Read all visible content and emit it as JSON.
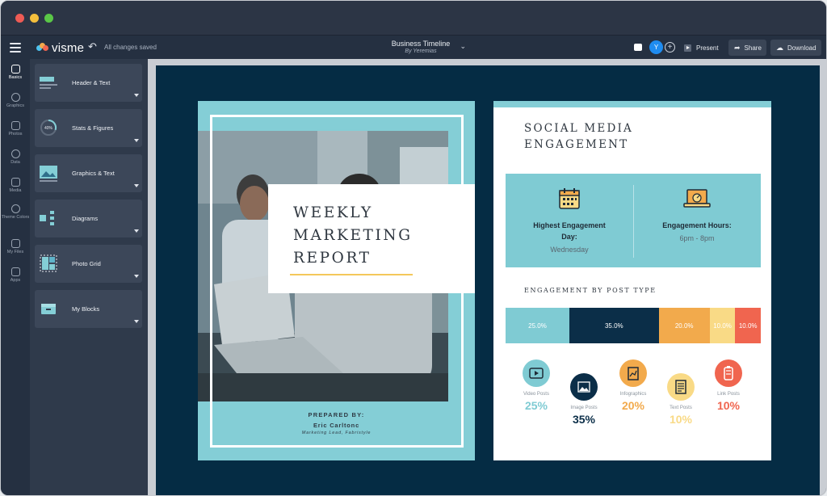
{
  "window": {
    "controls": [
      "close",
      "minimize",
      "maximize"
    ]
  },
  "topbar": {
    "logo_text": "visme",
    "save_status": "All changes saved",
    "doc_title": "Business Timeline",
    "doc_subtitle": "By Yeremias",
    "avatar_initial": "Y",
    "present_label": "Present",
    "share_label": "Share",
    "download_label": "Download"
  },
  "sidebar": {
    "items": [
      {
        "label": "Basics",
        "icon": "shapes-icon"
      },
      {
        "label": "Graphics",
        "icon": "graphics-icon"
      },
      {
        "label": "Photos",
        "icon": "photo-icon"
      },
      {
        "label": "Data",
        "icon": "chart-icon"
      },
      {
        "label": "Media",
        "icon": "media-icon"
      },
      {
        "label": "Theme Colors",
        "icon": "palette-icon"
      },
      {
        "label": "My Files",
        "icon": "folder-icon"
      },
      {
        "label": "Apps",
        "icon": "apps-icon"
      }
    ]
  },
  "panel": {
    "cards": [
      {
        "label": "Header & Text"
      },
      {
        "label": "Stats & Figures",
        "thumb_text": "40%"
      },
      {
        "label": "Graphics & Text"
      },
      {
        "label": "Diagrams"
      },
      {
        "label": "Photo Grid"
      },
      {
        "label": "My Blocks"
      }
    ]
  },
  "page1": {
    "title_lines": [
      "WEEKLY",
      "MARKETING",
      "REPORT"
    ],
    "prepared_by": "PREPARED BY:",
    "author": "Eric Carltonc",
    "role": "Marketing Lead, Fabristyle",
    "colors": {
      "frame": "#84ced6",
      "accent": "#f4c85b"
    }
  },
  "page2": {
    "title_line1": "SOCIAL MEDIA",
    "title_line2": "ENGAGEMENT",
    "highest_day_label": "Highest Engagement Day:",
    "highest_day_value": "Wednesday",
    "hours_label": "Engagement Hours:",
    "hours_value": "6pm - 8pm",
    "section_title": "ENGAGEMENT BY POST TYPE",
    "bar": [
      {
        "label": "25.0%",
        "value": 25,
        "color": "#7fcbd3"
      },
      {
        "label": "35.0%",
        "value": 35,
        "color": "#0b2e48"
      },
      {
        "label": "20.0%",
        "value": 20,
        "color": "#f2aa4c"
      },
      {
        "label": "10.0%",
        "value": 10,
        "color": "#f9da86"
      },
      {
        "label": "10.0%",
        "value": 10,
        "color": "#f0654f"
      }
    ],
    "posts": [
      {
        "name": "Video Posts",
        "pct": "25%",
        "color": "#7fcbd3",
        "icon": "video-icon"
      },
      {
        "name": "Image Posts",
        "pct": "35%",
        "color": "#0b2e48",
        "icon": "image-icon"
      },
      {
        "name": "Infographics",
        "pct": "20%",
        "color": "#f2aa4c",
        "icon": "infographic-icon"
      },
      {
        "name": "Text Posts",
        "pct": "10%",
        "color": "#f9da86",
        "icon": "text-post-icon"
      },
      {
        "name": "Link Posts",
        "pct": "10%",
        "color": "#f0654f",
        "icon": "link-post-icon"
      }
    ]
  }
}
